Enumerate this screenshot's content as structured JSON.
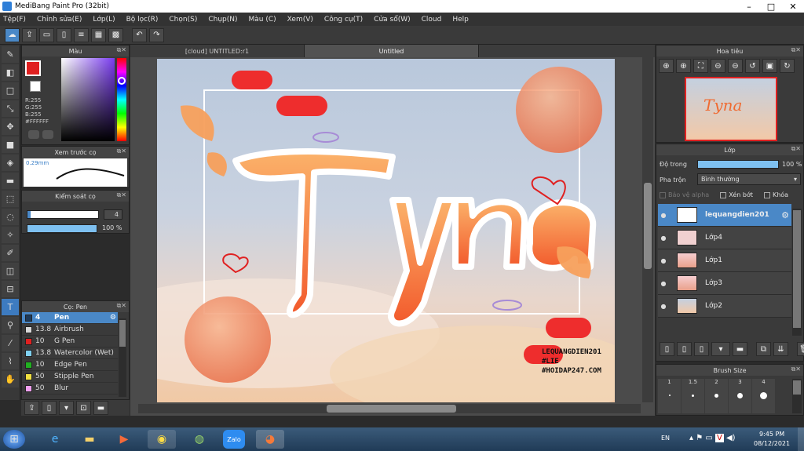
{
  "window": {
    "title": "MediBang Paint Pro (32bit)"
  },
  "menu": [
    "Tệp(F)",
    "Chỉnh sửa(E)",
    "Lớp(L)",
    "Bộ lọc(R)",
    "Chọn(S)",
    "Chụp(N)",
    "Màu (C)",
    "Xem(V)",
    "Công cụ(T)",
    "Cửa sổ(W)",
    "Cloud",
    "Help"
  ],
  "color_panel": {
    "title": "Màu",
    "r": "R:255",
    "g": "G:255",
    "b": "B:255",
    "hex": "#FFFFFF",
    "primary": "#e02020",
    "secondary": "#ffffff"
  },
  "preview_panel": {
    "title": "Xem trước cọ",
    "size": "0.29mm"
  },
  "control_panel": {
    "title": "Kiểm soát cọ",
    "size": "4",
    "opacity": "100 %"
  },
  "brush_panel": {
    "title": "Cọ: Pen",
    "items": [
      {
        "size": "4",
        "name": "Pen",
        "color": "#1e3a5a"
      },
      {
        "size": "13.8",
        "name": "Airbrush",
        "color": "#d8d8d8"
      },
      {
        "size": "10",
        "name": "G Pen",
        "color": "#e02020"
      },
      {
        "size": "13.8",
        "name": "Watercolor (Wet)",
        "color": "#7fd0f0"
      },
      {
        "size": "10",
        "name": "Edge Pen",
        "color": "#20b020"
      },
      {
        "size": "50",
        "name": "Stipple Pen",
        "color": "#f0e040"
      },
      {
        "size": "50",
        "name": "Blur",
        "color": "#f0a0f0"
      }
    ]
  },
  "tabs": [
    "[cloud] UNTITLED:r1",
    "Untitled"
  ],
  "artwork": {
    "text": "Tyna",
    "signature": [
      "LEQUANGDIEN201",
      "#LIE",
      "#HOIDAP247.COM"
    ]
  },
  "nav_panel": {
    "title": "Hoa tiêu"
  },
  "layer_panel": {
    "title": "Lớp",
    "opacity_label": "Độ trong",
    "opacity_value": "100 %",
    "blend_label": "Pha trộn",
    "blend_value": "Bình thường",
    "protect_alpha": "Bảo vệ alpha",
    "clip": "Xén bớt",
    "lock": "Khóa",
    "layers": [
      "lequangdien201",
      "Lớp4",
      "Lớp1",
      "Lớp3",
      "Lớp2"
    ]
  },
  "brush_size_panel": {
    "title": "Brush Size",
    "sizes": [
      "1",
      "1.5",
      "2",
      "3",
      "4"
    ]
  },
  "taskbar": {
    "lang": "EN",
    "time": "9:45 PM",
    "date": "08/12/2021",
    "zalo": "Zalo"
  }
}
